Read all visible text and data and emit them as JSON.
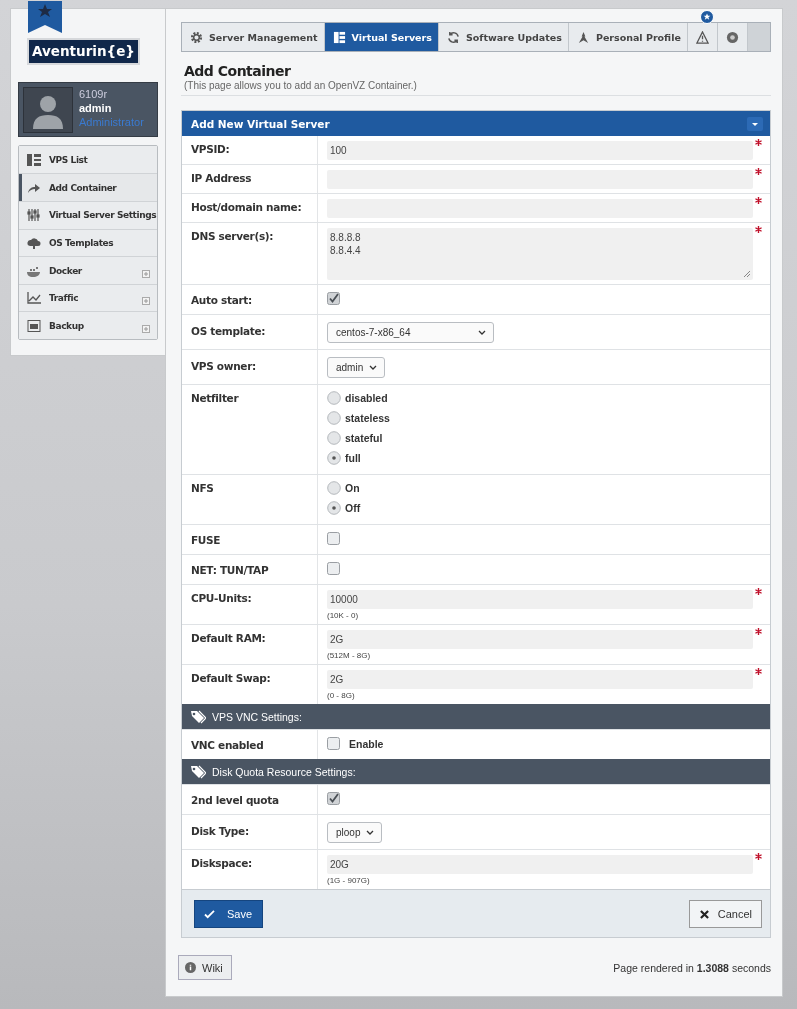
{
  "logo": {
    "text": "Aventurin{e}"
  },
  "user": {
    "id": "6109r",
    "name": "admin",
    "role": "Administrator"
  },
  "sidebar": {
    "items": [
      {
        "label": "VPS List",
        "selected": false,
        "has_submenu": false
      },
      {
        "label": "Add Container",
        "selected": true,
        "has_submenu": false
      },
      {
        "label": "Virtual Server Settings",
        "selected": false,
        "has_submenu": false
      },
      {
        "label": "OS Templates",
        "selected": false,
        "has_submenu": false
      },
      {
        "label": "Docker",
        "selected": false,
        "has_submenu": true
      },
      {
        "label": "Traffic",
        "selected": false,
        "has_submenu": true
      },
      {
        "label": "Backup",
        "selected": false,
        "has_submenu": true
      }
    ]
  },
  "tabs": [
    {
      "label": "Server Management",
      "selected": false
    },
    {
      "label": "Virtual Servers",
      "selected": true
    },
    {
      "label": "Software Updates",
      "selected": false
    },
    {
      "label": "Personal Profile",
      "selected": false
    },
    {
      "selected": false,
      "badge": true
    },
    {
      "selected": false
    }
  ],
  "page": {
    "title": "Add Container",
    "subtitle": "(This page allows you to add an OpenVZ Container.)"
  },
  "form": {
    "title": "Add New Virtual Server",
    "rows": [
      {
        "kind": "text",
        "label": "VPSID:",
        "value": "100",
        "required": true
      },
      {
        "kind": "text",
        "label": "IP Address",
        "required": true
      },
      {
        "kind": "text",
        "label": "Host/domain name:",
        "required": true
      },
      {
        "kind": "textarea",
        "label": "DNS server(s):",
        "lines": [
          "8.8.8.8",
          "8.8.4.4"
        ],
        "required": true
      },
      {
        "kind": "checkbox",
        "label": "Auto start:",
        "checked": true
      },
      {
        "kind": "select",
        "label": "OS template:",
        "value": "centos-7-x86_64",
        "wide": true
      },
      {
        "kind": "select",
        "label": "VPS owner:",
        "value": "admin",
        "wide": false
      },
      {
        "kind": "radios",
        "label": "Netfilter",
        "options": [
          {
            "label": "disabled",
            "selected": false
          },
          {
            "label": "stateless",
            "selected": false
          },
          {
            "label": "stateful",
            "selected": false
          },
          {
            "label": "full",
            "selected": true
          }
        ]
      },
      {
        "kind": "radios",
        "label": "NFS",
        "options": [
          {
            "label": "On",
            "selected": false
          },
          {
            "label": "Off",
            "selected": true
          }
        ]
      },
      {
        "kind": "checkbox",
        "label": "FUSE",
        "checked": false
      },
      {
        "kind": "checkbox",
        "label": "NET: TUN/TAP",
        "checked": false
      },
      {
        "kind": "text",
        "label": "CPU-Units:",
        "value": "10000",
        "hint": "(10K - 0)",
        "required": true
      },
      {
        "kind": "text",
        "label": "Default RAM:",
        "value": "2G",
        "hint": "(512M - 8G)",
        "required": true
      },
      {
        "kind": "text",
        "label": "Default Swap:",
        "value": "2G",
        "hint": "(0 - 8G)",
        "required": true
      },
      {
        "kind": "section",
        "label": "VPS VNC Settings:"
      },
      {
        "kind": "checkbox",
        "label": "VNC enabled",
        "checked": false,
        "text": "Enable"
      },
      {
        "kind": "section",
        "label": "Disk Quota Resource Settings:"
      },
      {
        "kind": "checkbox",
        "label": "2nd level quota",
        "checked": true
      },
      {
        "kind": "select",
        "label": "Disk Type:",
        "value": "ploop",
        "wide": false
      },
      {
        "kind": "text",
        "label": "Diskspace:",
        "value": "20G",
        "hint": "(1G - 907G)",
        "required": true
      }
    ],
    "buttons": {
      "save": "Save",
      "cancel": "Cancel"
    }
  },
  "footer": {
    "wiki": "Wiki",
    "rendered_prefix": "Page rendered in",
    "rendered_time": "1.3088",
    "rendered_suffix": "seconds"
  }
}
